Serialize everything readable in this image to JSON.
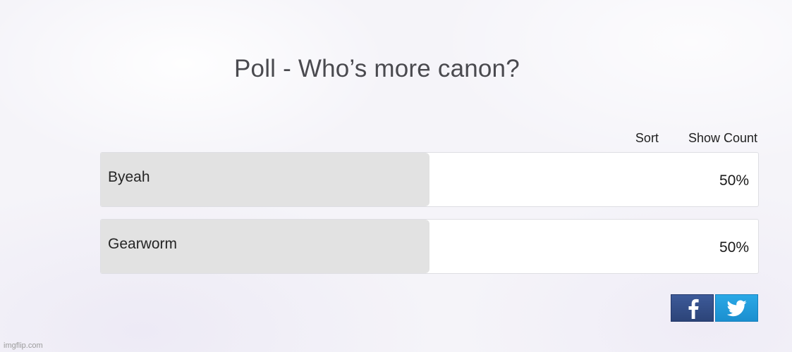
{
  "poll": {
    "title": "Poll - Who’s more canon?",
    "controls": {
      "sort_label": "Sort",
      "show_count_label": "Show Count"
    },
    "options": [
      {
        "label": "Byeah",
        "percent_text": "50%",
        "share": 0.5
      },
      {
        "label": "Gearworm",
        "percent_text": "50%",
        "share": 0.5
      }
    ]
  },
  "share": {
    "facebook_icon": "facebook-icon",
    "twitter_icon": "twitter-icon"
  },
  "colors": {
    "bar_fill": "#e2e2e2",
    "facebook": "#3b5998",
    "twitter": "#1da1f2"
  },
  "watermark": "imgflip.com"
}
